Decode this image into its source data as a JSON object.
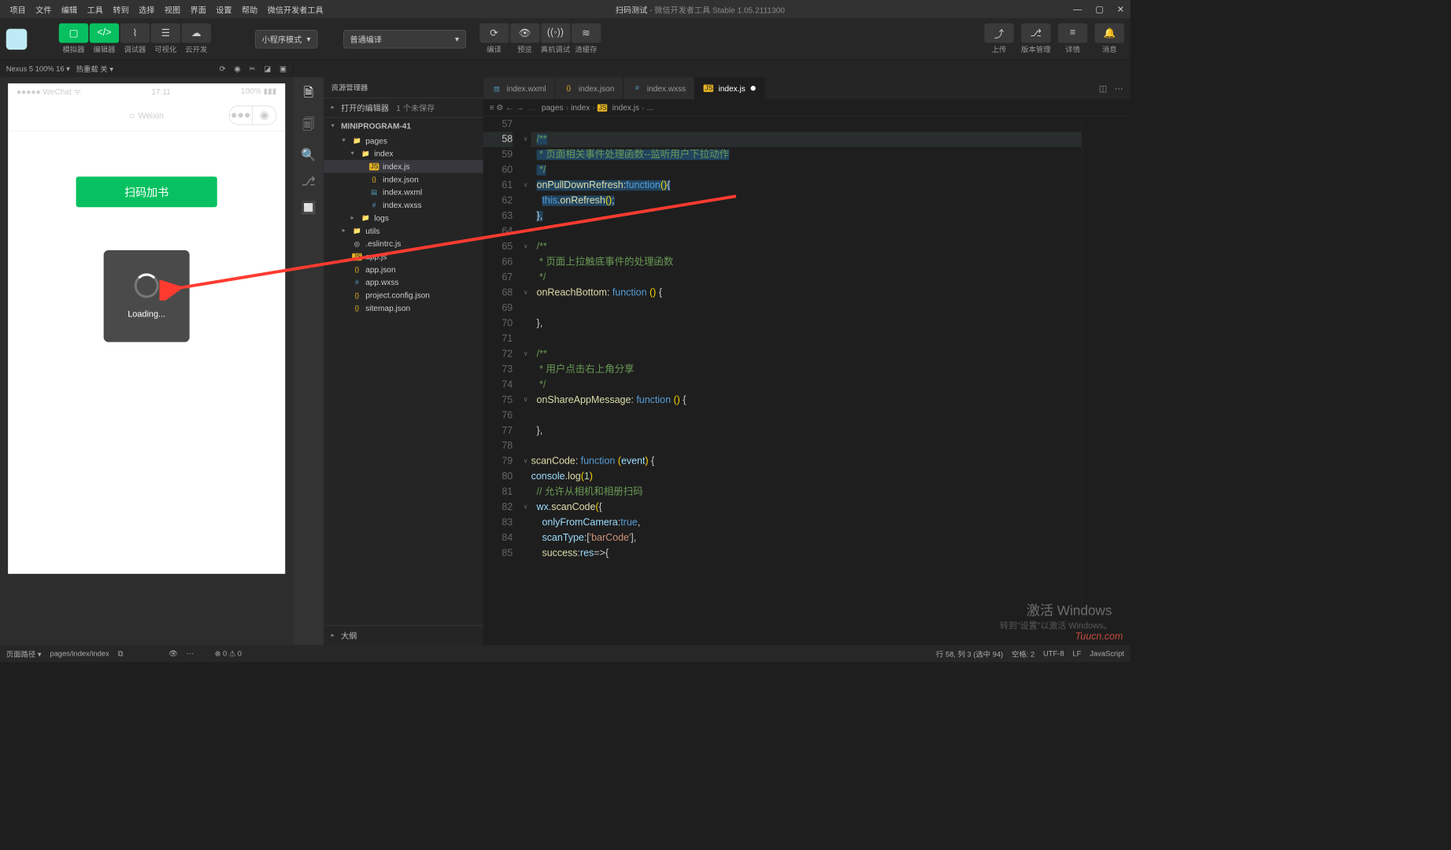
{
  "titlebar": {
    "menus": [
      "项目",
      "文件",
      "编辑",
      "工具",
      "转到",
      "选择",
      "视图",
      "界面",
      "设置",
      "帮助",
      "微信开发者工具"
    ],
    "title_prefix": "扫码测试",
    "title_suffix": " - 微信开发者工具 Stable 1.05.2111300",
    "win_min": "—",
    "win_max": "▢",
    "win_close": "✕"
  },
  "toolbar": {
    "groups": [
      {
        "icon": "▢",
        "label": "模拟器",
        "green": true
      },
      {
        "icon": "</>",
        "label": "编辑器",
        "green": true
      },
      {
        "icon": "⌇",
        "label": "调试器"
      },
      {
        "icon": "☰",
        "label": "可视化"
      },
      {
        "icon": "☁",
        "label": "云开发"
      }
    ],
    "mode_dropdown": "小程序模式",
    "compile_dropdown": "普通编译",
    "mid_buttons": [
      {
        "icon": "⟳",
        "label": "编译"
      },
      {
        "icon": "👁",
        "label": "预览"
      },
      {
        "icon": "((◦))",
        "label": "真机调试"
      },
      {
        "icon": "≋",
        "label": "清缓存"
      }
    ],
    "right_buttons": [
      {
        "icon": "⤴",
        "label": "上传"
      },
      {
        "icon": "⎇",
        "label": "版本管理"
      },
      {
        "icon": "≡",
        "label": "详情"
      },
      {
        "icon": "🔔",
        "label": "消息"
      }
    ]
  },
  "simbar": {
    "device": "Nexus 5 100% 16 ▾",
    "reload": "热重载 关 ▾",
    "icons": [
      "⟳",
      "◉",
      "✂",
      "◪",
      "▣"
    ]
  },
  "phone": {
    "carrier": "●●●●● WeChat",
    "wifi": "ᯤ",
    "time": "17:11",
    "battery": "100% ▮▮▮",
    "nav_title": "Weixin",
    "nav_dots": "●●●",
    "nav_target": "◉",
    "scan_button": "扫码加书",
    "loading": "Loading..."
  },
  "activity_icons": [
    "🗎",
    "🗐",
    "🔍",
    "⎇",
    "🔲"
  ],
  "explorer": {
    "title": "资源管理器",
    "open_editors": "打开的编辑器",
    "unsaved": "1 个未保存",
    "project": "MINIPROGRAM-41",
    "tree": [
      {
        "depth": 1,
        "twisty": "▾",
        "icon": "📁",
        "name": "pages",
        "iconClass": "",
        "sel": false
      },
      {
        "depth": 2,
        "twisty": "▾",
        "icon": "📁",
        "name": "index",
        "iconClass": "",
        "sel": false
      },
      {
        "depth": 3,
        "twisty": "",
        "icon": "JS",
        "name": "index.js",
        "iconClass": "js",
        "sel": true
      },
      {
        "depth": 3,
        "twisty": "",
        "icon": "{}",
        "name": "index.json",
        "iconClass": "json",
        "sel": false
      },
      {
        "depth": 3,
        "twisty": "",
        "icon": "▤",
        "name": "index.wxml",
        "iconClass": "wxml",
        "sel": false
      },
      {
        "depth": 3,
        "twisty": "",
        "icon": "#",
        "name": "index.wxss",
        "iconClass": "wxss",
        "sel": false
      },
      {
        "depth": 2,
        "twisty": "▸",
        "icon": "📁",
        "name": "logs",
        "iconClass": "",
        "sel": false
      },
      {
        "depth": 1,
        "twisty": "▸",
        "icon": "📁",
        "name": "utils",
        "iconClass": "",
        "sel": false
      },
      {
        "depth": 1,
        "twisty": "",
        "icon": "◎",
        "name": ".eslintrc.js",
        "iconClass": "",
        "sel": false
      },
      {
        "depth": 1,
        "twisty": "",
        "icon": "JS",
        "name": "app.js",
        "iconClass": "js",
        "sel": false
      },
      {
        "depth": 1,
        "twisty": "",
        "icon": "{}",
        "name": "app.json",
        "iconClass": "json",
        "sel": false
      },
      {
        "depth": 1,
        "twisty": "",
        "icon": "#",
        "name": "app.wxss",
        "iconClass": "wxss",
        "sel": false
      },
      {
        "depth": 1,
        "twisty": "",
        "icon": "{}",
        "name": "project.config.json",
        "iconClass": "json",
        "sel": false
      },
      {
        "depth": 1,
        "twisty": "",
        "icon": "{}",
        "name": "sitemap.json",
        "iconClass": "json",
        "sel": false
      }
    ],
    "outline": "大纲"
  },
  "tabs": [
    {
      "icon": "▤",
      "label": "index.wxml",
      "active": false,
      "iconClass": "wxml"
    },
    {
      "icon": "{}",
      "label": "index.json",
      "active": false,
      "iconClass": "json"
    },
    {
      "icon": "#",
      "label": "index.wxss",
      "active": false,
      "iconClass": "wxss"
    },
    {
      "icon": "JS",
      "label": "index.js",
      "active": true,
      "dirty": true,
      "iconClass": "js"
    }
  ],
  "breadcrumb": {
    "items": [
      "pages",
      "index",
      "index.js",
      "..."
    ],
    "js_icon": "JS"
  },
  "code": {
    "start": 57,
    "active_line": 58,
    "lines": [
      {
        "n": 57,
        "fold": "",
        "html": ""
      },
      {
        "n": 58,
        "fold": "∨",
        "html": "  <span class='sel'><span class='c-comment'>/**</span></span>"
      },
      {
        "n": 59,
        "fold": "",
        "html": "  <span class='sel'><span class='c-comment'> * 页面相关事件处理函数--监听用户下拉动作</span></span>"
      },
      {
        "n": 60,
        "fold": "",
        "html": "  <span class='sel'><span class='c-comment'> */</span></span>"
      },
      {
        "n": 61,
        "fold": "∨",
        "html": "  <span class='sel'><span class='c-func'>onPullDownRefresh</span>:<span class='c-keyword'>function</span><span class='c-paren'>()</span>{</span>"
      },
      {
        "n": 62,
        "fold": "",
        "html": "    <span class='sel'><span class='c-const'>this</span>.<span class='c-func'>onRefresh</span><span class='c-paren'>()</span>;</span>"
      },
      {
        "n": 63,
        "fold": "",
        "html": "  <span class='sel'>},</span>"
      },
      {
        "n": 64,
        "fold": "",
        "html": ""
      },
      {
        "n": 65,
        "fold": "∨",
        "html": "  <span class='c-comment'>/**</span>"
      },
      {
        "n": 66,
        "fold": "",
        "html": "  <span class='c-comment'> * 页面上拉触底事件的处理函数</span>"
      },
      {
        "n": 67,
        "fold": "",
        "html": "  <span class='c-comment'> */</span>"
      },
      {
        "n": 68,
        "fold": "∨",
        "html": "  <span class='c-func'>onReachBottom</span>: <span class='c-keyword'>function</span> <span class='c-paren'>()</span> {"
      },
      {
        "n": 69,
        "fold": "",
        "html": ""
      },
      {
        "n": 70,
        "fold": "",
        "html": "  },"
      },
      {
        "n": 71,
        "fold": "",
        "html": ""
      },
      {
        "n": 72,
        "fold": "∨",
        "html": "  <span class='c-comment'>/**</span>"
      },
      {
        "n": 73,
        "fold": "",
        "html": "  <span class='c-comment'> * 用户点击右上角分享</span>"
      },
      {
        "n": 74,
        "fold": "",
        "html": "  <span class='c-comment'> */</span>"
      },
      {
        "n": 75,
        "fold": "∨",
        "html": "  <span class='c-func'>onShareAppMessage</span>: <span class='c-keyword'>function</span> <span class='c-paren'>()</span> {"
      },
      {
        "n": 76,
        "fold": "",
        "html": ""
      },
      {
        "n": 77,
        "fold": "",
        "html": "  },"
      },
      {
        "n": 78,
        "fold": "",
        "html": ""
      },
      {
        "n": 79,
        "fold": "∨",
        "html": "<span class='c-func'>scanCode</span>: <span class='c-keyword'>function</span> <span class='c-paren'>(</span><span class='c-prop'>event</span><span class='c-paren'>)</span> {"
      },
      {
        "n": 80,
        "fold": "",
        "html": "<span class='c-prop'>console</span>.<span class='c-func'>log</span><span class='c-paren'>(</span><span class='c-num'>1</span><span class='c-paren'>)</span>"
      },
      {
        "n": 81,
        "fold": "",
        "html": "  <span class='c-comment'>// 允许从相机和相册扫码</span>"
      },
      {
        "n": 82,
        "fold": "∨",
        "html": "  <span class='c-prop'>wx</span>.<span class='c-func'>scanCode</span><span class='c-paren'>(</span>{"
      },
      {
        "n": 83,
        "fold": "",
        "html": "    <span class='c-prop'>onlyFromCamera</span>:<span class='c-const'>true</span>,"
      },
      {
        "n": 84,
        "fold": "",
        "html": "    <span class='c-prop'>scanType</span>:[<span class='c-str'>'barCode'</span>],"
      },
      {
        "n": 85,
        "fold": "",
        "html": "    <span class='c-func'>success</span>:<span class='c-prop'>res</span>=&gt;{"
      }
    ]
  },
  "statusbar": {
    "path_label": "页面路径 ▾",
    "path": "pages/index/index",
    "copy": "⧉",
    "errors": "⊗ 0 ⚠ 0",
    "pos": "行 58, 列 3 (选中 94)",
    "spaces": "空格: 2",
    "enc": "UTF-8",
    "eol": "LF",
    "lang": "JavaScript"
  },
  "watermark": {
    "l1": "激活 Windows",
    "l2": "转到\"设置\"以激活 Windows。"
  },
  "watermark2": "Tuucn.com"
}
